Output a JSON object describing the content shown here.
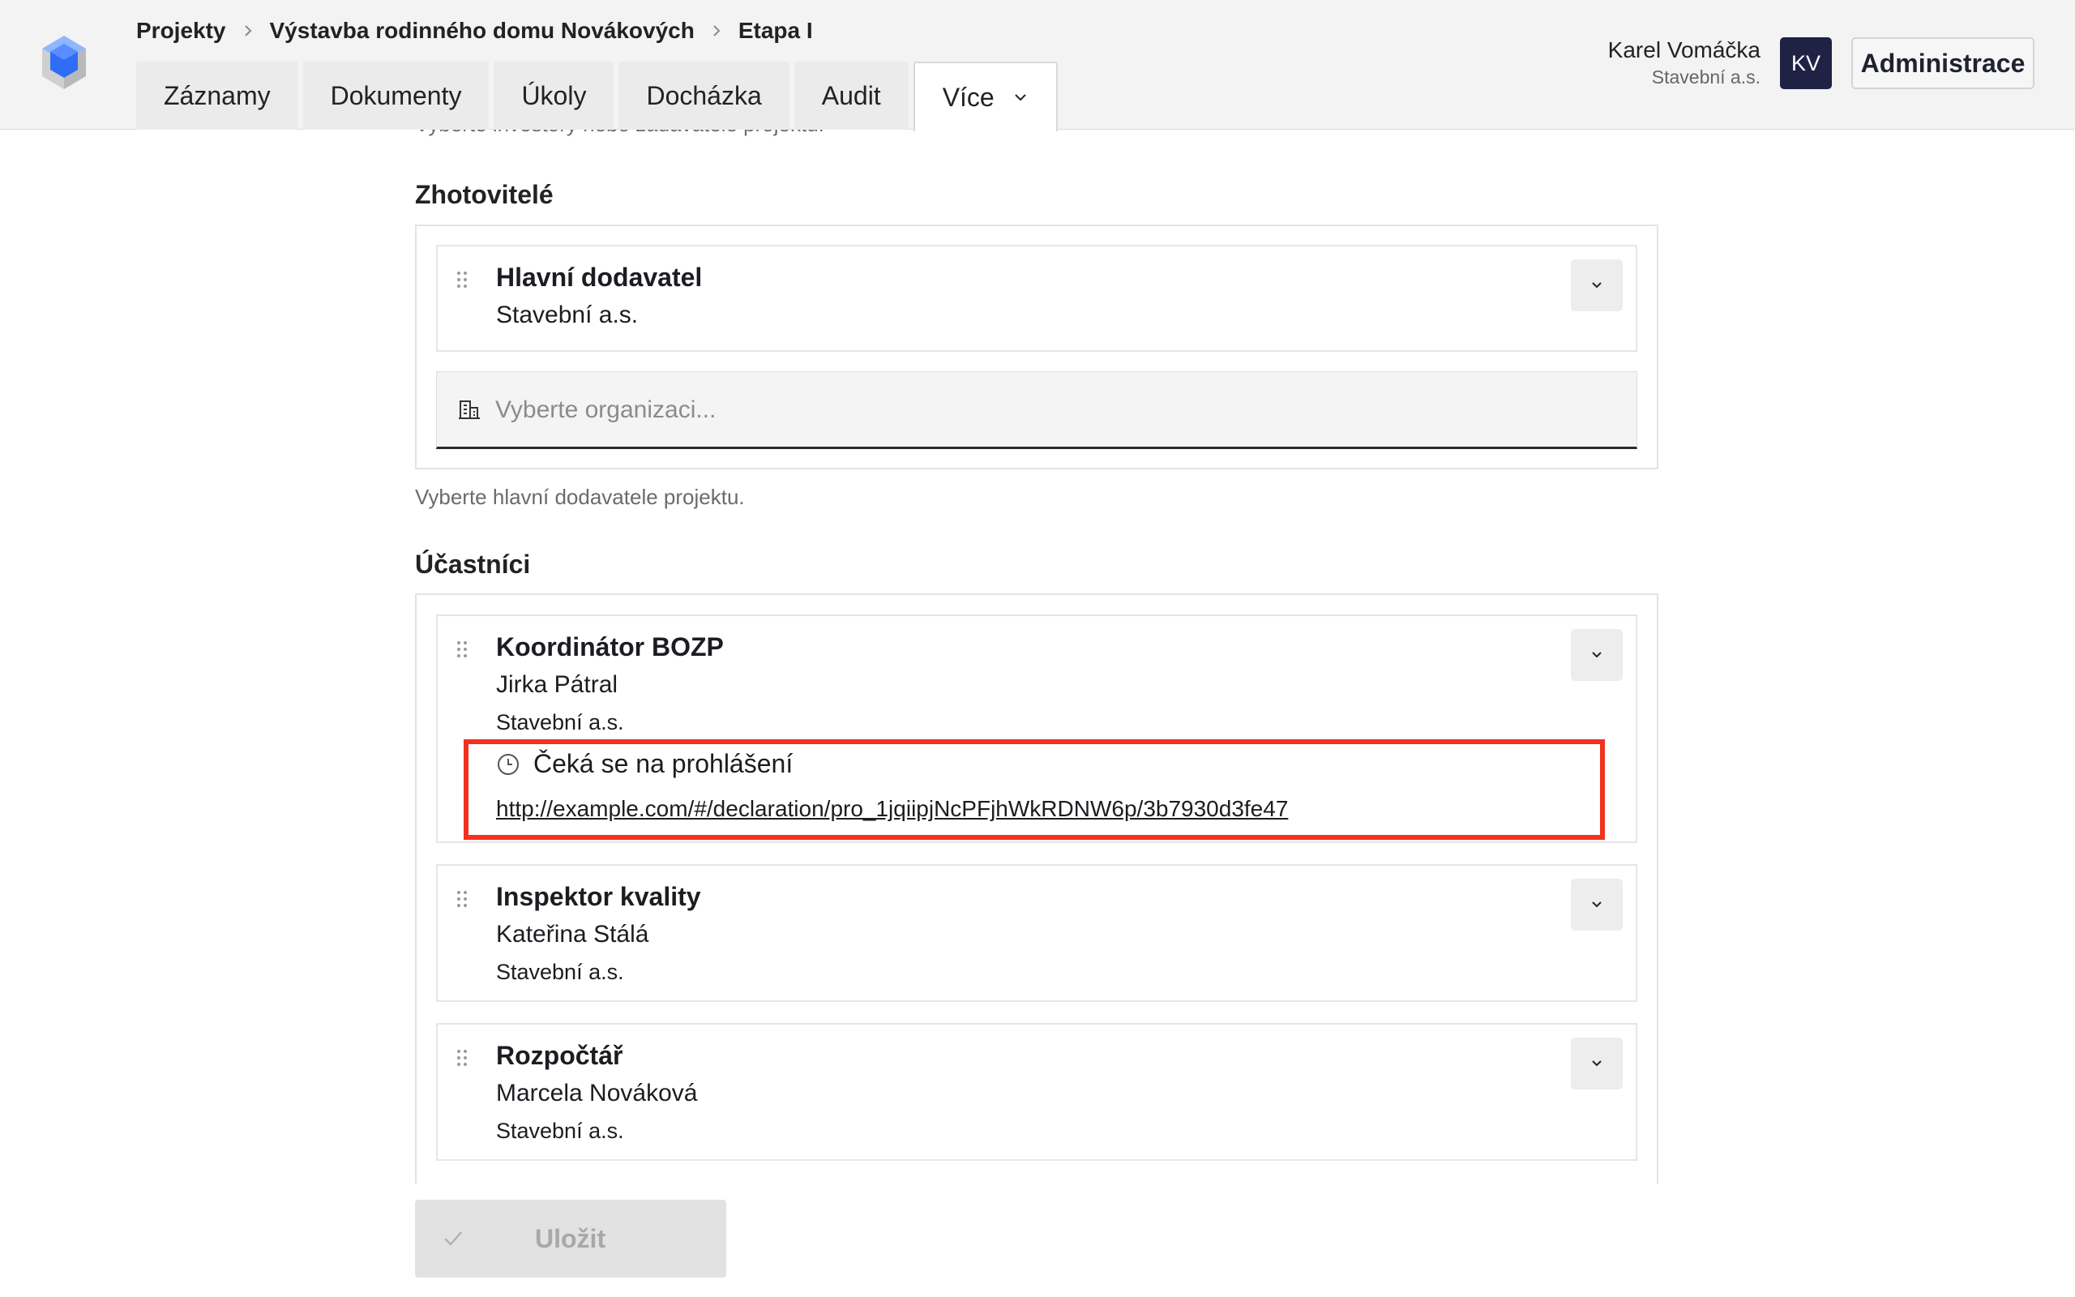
{
  "breadcrumb": [
    "Projekty",
    "Výstavba rodinného domu Novákových",
    "Etapa I"
  ],
  "tabs": [
    {
      "label": "Záznamy",
      "active": false
    },
    {
      "label": "Dokumenty",
      "active": false
    },
    {
      "label": "Úkoly",
      "active": false
    },
    {
      "label": "Docházka",
      "active": false
    },
    {
      "label": "Audit",
      "active": false
    },
    {
      "label": "Více",
      "active": true
    }
  ],
  "user": {
    "name": "Karel Vomáčka",
    "org": "Stavební a.s.",
    "initials": "KV",
    "admin_label": "Administrace"
  },
  "investors_helper": "Vyberte investory nebo zadavatele projektu.",
  "contractors": {
    "title": "Zhotovitelé",
    "cards": [
      {
        "role": "Hlavní dodavatel",
        "name": "Stavební a.s."
      }
    ],
    "select_placeholder": "Vyberte organizaci...",
    "helper": "Vyberte hlavní dodavatele projektu."
  },
  "participants": {
    "title": "Účastníci",
    "cards": [
      {
        "role": "Koordinátor BOZP",
        "name": "Jirka Pátral",
        "org": "Stavební a.s.",
        "status": "Čeká se na prohlášení",
        "link": "http://example.com/#/declaration/pro_1jqiipjNcPFjhWkRDNW6p/3b7930d3fe47"
      },
      {
        "role": "Inspektor kvality",
        "name": "Kateřina Stálá",
        "org": "Stavební a.s."
      },
      {
        "role": "Rozpočtář",
        "name": "Marcela Nováková",
        "org": "Stavební a.s."
      }
    ]
  },
  "save_label": "Uložit",
  "colors": {
    "avatar_bg": "#1f2245",
    "highlight": "#f2311e",
    "logo_blue": "#2f6df6"
  },
  "icons": {
    "logo": "cube-logo-icon",
    "sep": "chevron-right-icon",
    "more": "chevron-down-icon",
    "drag": "drag-handle-icon",
    "building": "building-icon",
    "clock": "clock-icon",
    "check": "check-icon"
  }
}
